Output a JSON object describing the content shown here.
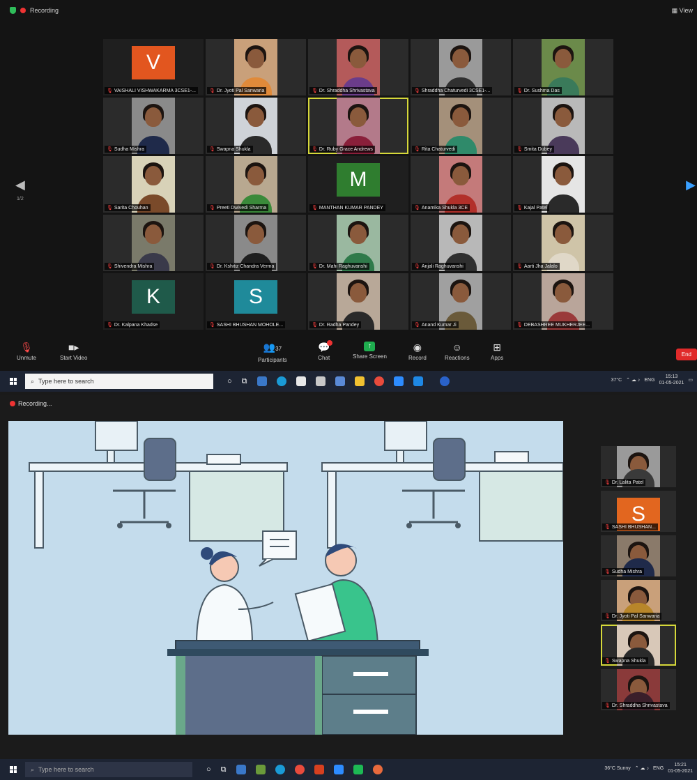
{
  "top": {
    "recording_label": "Recording",
    "view_label": "View",
    "page_left": "1/2",
    "participants": [
      {
        "name": "VAISHALI VISHWAKARMA 3CSE1-...",
        "avatar": "V",
        "avatar_color": "#e2561f"
      },
      {
        "name": "Dr. Jyoti Pal Sanwaria",
        "photo": "#c9a07a",
        "shirt": "#e08a3a"
      },
      {
        "name": "Dr. Shraddha Shrivastava",
        "photo": "#b45a5a",
        "shirt": "#6b3c8a"
      },
      {
        "name": "Shraddha Chaturvedi 3CSE1-...",
        "photo": "#9a9a9a",
        "shirt": "#303030"
      },
      {
        "name": "Dr. Sushma Das",
        "photo": "#6b8a4a",
        "shirt": "#3a7a5a"
      },
      {
        "name": "Sudha Mishra",
        "photo": "#8a8a8a",
        "shirt": "#1f2a4a"
      },
      {
        "name": "Swapna Shukla",
        "photo": "#cfd3d8",
        "shirt": "#2a2a2a"
      },
      {
        "name": "Dr. Ruby Grace Andrews",
        "photo": "#b37a8a",
        "shirt": "#8a1f3a",
        "active": true
      },
      {
        "name": "Rita Chaturvedi",
        "photo": "#a4907a",
        "shirt": "#2f8a6a"
      },
      {
        "name": "Smita Dubey",
        "photo": "#b9b9b9",
        "shirt": "#4a3a5a"
      },
      {
        "name": "Sarita Chouhan",
        "photo": "#d8d2b8",
        "shirt": "#7a4a2a"
      },
      {
        "name": "Preeti Dwivedi Sharma",
        "photo": "#b8a890",
        "shirt": "#3a8a3a"
      },
      {
        "name": "MANTHAN KUMAR PANDEY",
        "avatar": "M",
        "avatar_color": "#2f7d2f"
      },
      {
        "name": "Anamika Shukla 3CE",
        "photo": "#c47a7a",
        "shirt": "#b2302a"
      },
      {
        "name": "Kajal Patel",
        "photo": "#e5e5e5",
        "shirt": "#2a2a2a"
      },
      {
        "name": "Shivendra Mishra",
        "photo": "#7a7a6a",
        "shirt": "#3a3a4a"
      },
      {
        "name": "Dr. Kshitiz Chandra Verma",
        "photo": "#8a8a8a",
        "shirt": "#1f1f1f"
      },
      {
        "name": "Dr. Mahi Raghuvanshi",
        "photo": "#9ab8a0",
        "shirt": "#2f7a4a"
      },
      {
        "name": "Anjali Raghuvanshi",
        "photo": "#b8b8b8",
        "shirt": "#2f2f2f"
      },
      {
        "name": "Aarti Jha Jalalo",
        "photo": "#cfc4a8",
        "shirt": "#e0d8c8"
      },
      {
        "name": "Dr. Kalpana Khadse",
        "avatar": "K",
        "avatar_color": "#1f5a4a"
      },
      {
        "name": "SASHI BHUSHAN MOHOLE...",
        "avatar": "S",
        "avatar_color": "#1f8a9a"
      },
      {
        "name": "Dr. Radha Pandey",
        "photo": "#b8a898",
        "shirt": "#2a2a2a"
      },
      {
        "name": "Anand Kumar Ji",
        "photo": "#a0a0a0",
        "shirt": "#6a5a3a"
      },
      {
        "name": "DEBASHREE MUKHERJEE...",
        "photo": "#b9a59a",
        "shirt": "#9a3a3a"
      }
    ],
    "toolbar": {
      "mute": "Unmute",
      "video": "Start Video",
      "participants": "Participants",
      "participants_count": "37",
      "chat": "Chat",
      "share": "Share Screen",
      "record": "Record",
      "reactions": "Reactions",
      "apps": "Apps",
      "end": "End"
    },
    "taskbar": {
      "search_placeholder": "Type here to search",
      "weather": "37°C",
      "lang": "ENG",
      "time": "15:13",
      "date": "01-05-2021"
    }
  },
  "bottom": {
    "recording_label": "Recording...",
    "side_participants": [
      {
        "name": "Dr. Lalita Patel",
        "photo": "#9a9a9a",
        "shirt": "#3a3a3a"
      },
      {
        "name": "SASHI BHUSHAN...",
        "avatar": "S",
        "avatar_color": "#e2661f"
      },
      {
        "name": "Sudha Mishra",
        "photo": "#8a7a6a",
        "shirt": "#1f2a4a"
      },
      {
        "name": "Dr. Jyoti Pal Sanwaria",
        "photo": "#c9a07a",
        "shirt": "#b8862a"
      },
      {
        "name": "Swapna Shukla",
        "photo": "#d8c8b8",
        "shirt": "#2a2a2a",
        "active": true
      },
      {
        "name": "Dr. Shraddha Shrivastava",
        "photo": "#8a3a3a",
        "shirt": "#3a1f2a"
      }
    ],
    "taskbar": {
      "search_placeholder": "Type here to search",
      "weather": "36°C Sunny",
      "lang": "ENG",
      "time": "15:21",
      "date": "01-05-2021"
    }
  }
}
